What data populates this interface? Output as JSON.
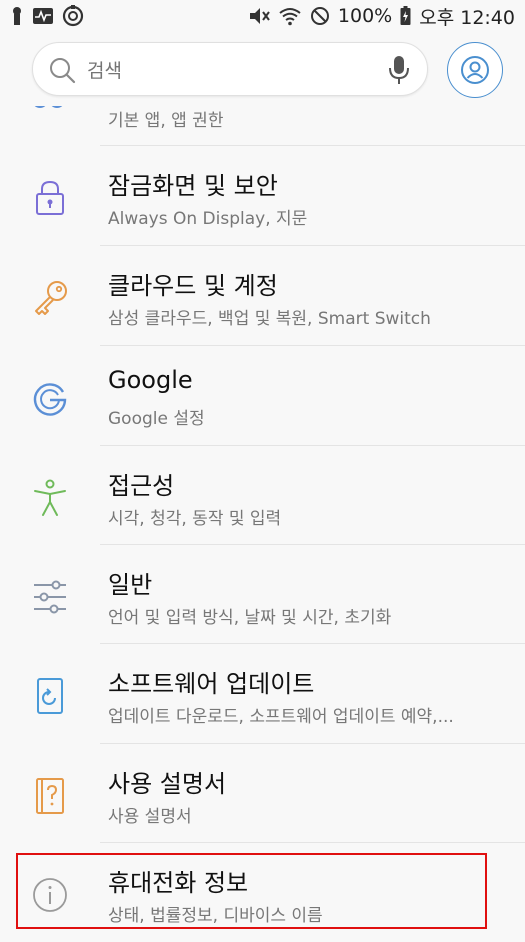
{
  "status_bar": {
    "battery": "100%",
    "time": "오후 12:40"
  },
  "search": {
    "placeholder": "검색"
  },
  "partial_item": {
    "subtitle": "기본 앱, 앱 권한"
  },
  "items": [
    {
      "title": "잠금화면 및 보안",
      "subtitle": "Always On Display, 지문",
      "icon": "lock-icon"
    },
    {
      "title": "클라우드 및 계정",
      "subtitle": "삼성 클라우드, 백업 및 복원, Smart Switch",
      "icon": "key-icon"
    },
    {
      "title": "Google",
      "subtitle": "Google 설정",
      "icon": "google-icon"
    },
    {
      "title": "접근성",
      "subtitle": "시각, 청각, 동작 및 입력",
      "icon": "accessibility-icon"
    },
    {
      "title": "일반",
      "subtitle": "언어 및 입력 방식, 날짜 및 시간, 초기화",
      "icon": "sliders-icon"
    },
    {
      "title": "소프트웨어 업데이트",
      "subtitle": "업데이트 다운로드, 소프트웨어 업데이트 예약,...",
      "icon": "software-update-icon"
    },
    {
      "title": "사용 설명서",
      "subtitle": "사용 설명서",
      "icon": "manual-icon"
    },
    {
      "title": "휴대전화 정보",
      "subtitle": "상태, 법률정보, 디바이스 이름",
      "icon": "info-icon"
    }
  ],
  "colors": {
    "accent": "#4a8fcf",
    "highlight": "#e01010"
  }
}
